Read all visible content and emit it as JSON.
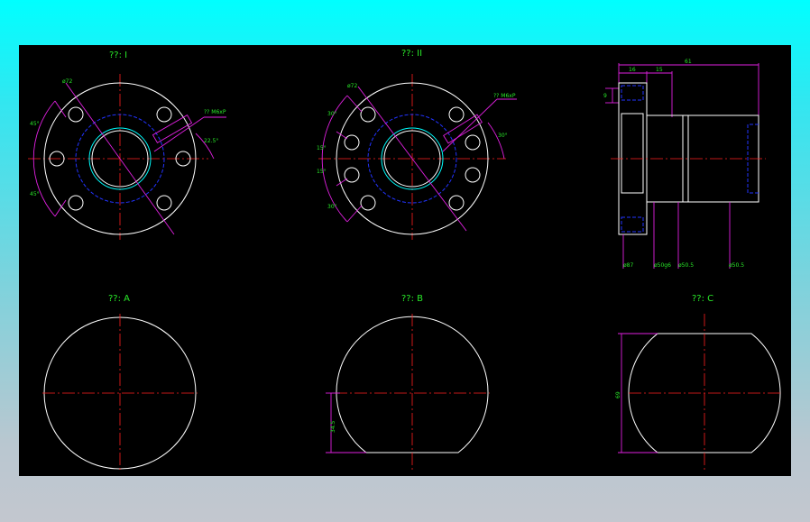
{
  "views": {
    "view1": {
      "title": "??: I"
    },
    "view2": {
      "title": "??: II"
    },
    "viewA": {
      "title": "??: A"
    },
    "viewB": {
      "title": "??: B"
    },
    "viewC": {
      "title": "??: C"
    }
  },
  "dims": {
    "v1_dia": "ø72",
    "v1_ang_top": "45°",
    "v1_ang_bot": "45°",
    "v1_hole": "?? M6xP",
    "v1_ang_right": "22.5°",
    "v2_dia": "ø72",
    "v2_ang1": "30°",
    "v2_ang2": "15°",
    "v2_ang3": "15°",
    "v2_ang4": "30°",
    "v2_hole": "?? M6xP",
    "v2_ang_right": "30°",
    "side_len_total": "61",
    "side_len_flange": "16",
    "side_len_mid": "15",
    "side_small": "9",
    "side_d1": "ø87",
    "side_d2": "ø50g6",
    "side_d3": "ø50.5",
    "side_d4": "ø50.5",
    "b_height": "34.5",
    "c_height": "69"
  }
}
